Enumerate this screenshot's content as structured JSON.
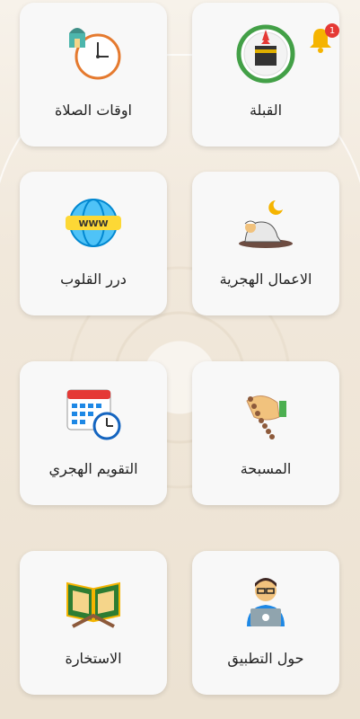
{
  "cards": [
    {
      "label": "القبلة",
      "icon": "kaaba-compass-icon"
    },
    {
      "label": "اوقات الصلاة",
      "icon": "mosque-clock-icon"
    },
    {
      "label": "الاعمال الهجرية",
      "icon": "praying-person-icon"
    },
    {
      "label": "درر القلوب",
      "icon": "www-globe-icon"
    },
    {
      "label": "المسبحة",
      "icon": "prayer-beads-icon"
    },
    {
      "label": "التقويم الهجري",
      "icon": "calendar-clock-icon"
    },
    {
      "label": "حول التطبيق",
      "icon": "developer-laptop-icon"
    },
    {
      "label": "الاستخارة",
      "icon": "quran-book-icon"
    }
  ],
  "notifications": {
    "count": "1",
    "icon": "bell-icon"
  },
  "colors": {
    "accent": "#4caf50",
    "bell": "#f5b400",
    "badge": "#e53935"
  }
}
